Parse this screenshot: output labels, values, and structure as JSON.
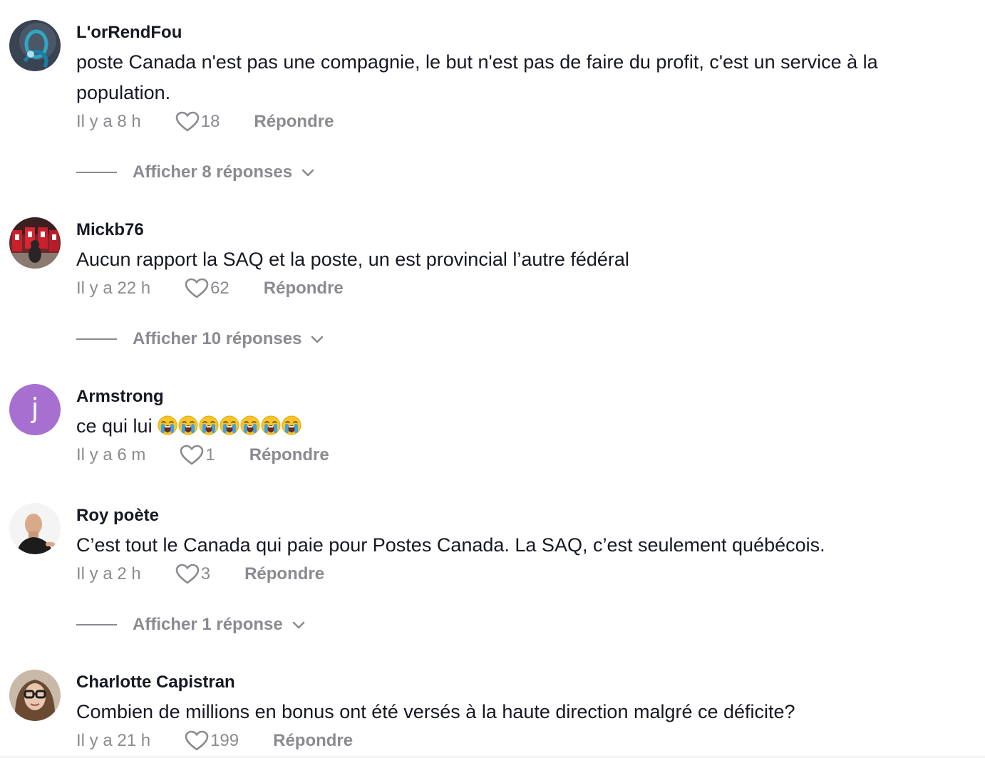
{
  "colors": {
    "text": "#161823",
    "muted": "#8a8b91",
    "avatar_j": "#a66fd0"
  },
  "comments": [
    {
      "username": "L'orRendFou",
      "text": "poste Canada n'est pas une compagnie, le but n'est pas de faire du profit, c'est un service à la population.",
      "time": "Il y a 8 h",
      "likes": "18",
      "reply_label": "Répondre",
      "view_replies": "Afficher 8 réponses",
      "avatar_icon": "blue-ribbon-avatar"
    },
    {
      "username": "Mickb76",
      "text": "Aucun rapport la SAQ et la poste, un est provincial l’autre fédéral",
      "time": "Il y a 22 h",
      "likes": "62",
      "reply_label": "Répondre",
      "view_replies": "Afficher 10 réponses",
      "avatar_icon": "hockey-locker-avatar"
    },
    {
      "username": "Armstrong",
      "text_prefix": "ce qui lui",
      "emoji_icon": "loudly-crying-face",
      "emoji_count": 7,
      "time": "Il y a 6 m",
      "likes": "1",
      "reply_label": "Répondre",
      "avatar_letter": "j"
    },
    {
      "username": "Roy poète",
      "text": "C’est tout le Canada qui paie pour Postes Canada. La SAQ, c’est seulement québécois.",
      "time": "Il y a 2 h",
      "likes": "3",
      "reply_label": "Répondre",
      "view_replies": "Afficher 1 réponse",
      "avatar_icon": "bald-man-avatar"
    },
    {
      "username": "Charlotte Capistran",
      "text": "Combien de millions en bonus ont été versés à la haute direction malgré ce déficite?",
      "time": "Il y a 21 h",
      "likes": "199",
      "reply_label": "Répondre",
      "avatar_icon": "woman-glasses-avatar"
    }
  ]
}
